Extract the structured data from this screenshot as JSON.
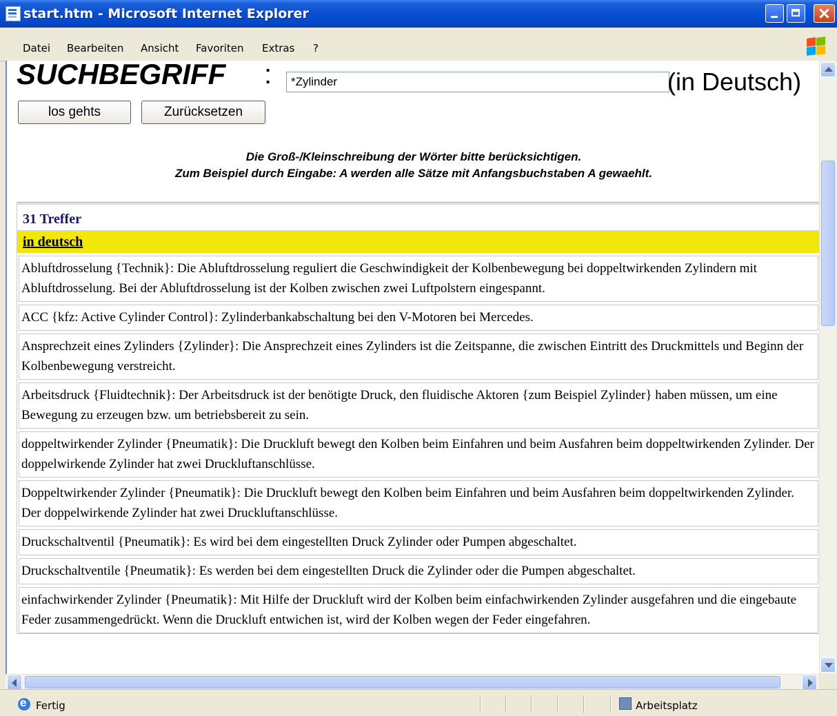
{
  "window": {
    "title": "start.htm - Microsoft Internet Explorer"
  },
  "menu": [
    "Datei",
    "Bearbeiten",
    "Ansicht",
    "Favoriten",
    "Extras",
    "?"
  ],
  "search": {
    "heading": "SUCHBEGRIFF",
    "colon": ":",
    "value": "*Zylinder",
    "language": "(in Deutsch)",
    "submit_label": "los gehts",
    "reset_label": "Zurücksetzen",
    "hint_line1": "Die Groß-/Kleinschreibung der Wörter bitte berücksichtigen.",
    "hint_line2": "Zum Beispiel durch Eingabe: A werden alle Sätze mit Anfangsbuchstaben A gewaehlt."
  },
  "results": {
    "count_label": "31 Treffer",
    "section_label": "in deutsch",
    "entries": [
      "Abluftdrosselung   {Technik}: Die Abluftdrosselung reguliert die Geschwindigkeit der Kolbenbewegung bei doppeltwirkenden Zylindern mit Abluftdrosselung. Bei der Abluftdrosselung ist der Kolben zwischen zwei Luftpolstern eingespannt.",
      "ACC {kfz: Active Cylinder Control}: Zylinderbankabschaltung bei den V-Motoren bei Mercedes.",
      "Ansprechzeit eines Zylinders   {Zylinder}: Die Ansprechzeit eines Zylinders ist die Zeitspanne, die zwischen Eintritt des Druckmittels und Beginn der Kolbenbewegung verstreicht.",
      "Arbeitsdruck   {Fluidtechnik}: Der Arbeitsdruck ist der benötigte Druck, den fluidische Aktoren {zum Beispiel Zylinder} haben müssen, um eine Bewegung zu erzeugen bzw. um betriebsbereit zu sein.",
      "doppeltwirkender Zylinder    {Pneumatik}: Die Druckluft bewegt den Kolben beim Einfahren und beim Ausfahren beim doppeltwirkenden Zylinder. Der doppelwirkende Zylinder hat zwei Druckluftanschlüsse.",
      "Doppeltwirkender Zylinder    {Pneumatik}: Die Druckluft bewegt den Kolben beim Einfahren und beim Ausfahren beim doppeltwirkenden Zylinder. Der doppelwirkende Zylinder hat zwei Druckluftanschlüsse.",
      "Druckschaltventil    {Pneumatik}: Es wird bei dem eingestellten Druck  Zylinder oder Pumpen abgeschaltet.",
      "Druckschaltventile    {Pneumatik}: Es werden bei dem eingestellten Druck  die Zylinder oder die Pumpen abgeschaltet.",
      "einfachwirkender Zylinder    {Pneumatik}: Mit Hilfe der Druckluft wird der Kolben beim einfachwirkenden Zylinder ausgefahren und die eingebaute Feder zusammengedrückt. Wenn die Druckluft entwichen ist, wird der Kolben wegen der Feder eingefahren."
    ]
  },
  "status": {
    "text": "Fertig",
    "zone": "Arbeitsplatz"
  }
}
